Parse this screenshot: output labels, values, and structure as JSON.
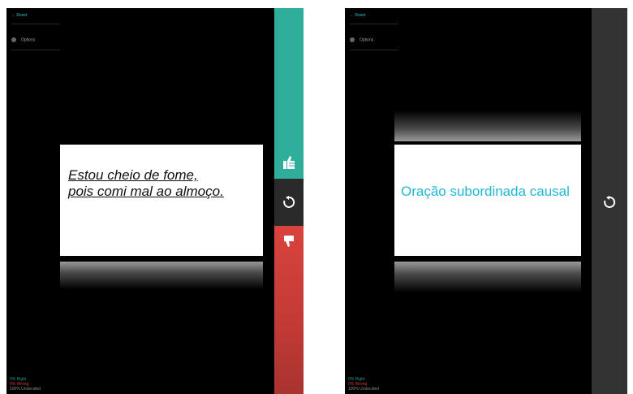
{
  "left": {
    "header": {
      "back_label": "← Reset",
      "options_label": "Options"
    },
    "sentence_line1": "Estou cheio de fome,",
    "sentence_line2": "pois comi mal ao almoço.",
    "actions": {
      "right_icon": "thumbs-up-icon",
      "undo_icon": "undo-icon",
      "wrong_icon": "thumbs-down-icon"
    },
    "stats": {
      "right": "0% Right",
      "wrong": "0% Wrong",
      "undecided": "100% Undecided"
    },
    "colors": {
      "right": "#2eae9b",
      "undo": "#2a2a2a",
      "wrong": "#d9433d"
    }
  },
  "right": {
    "header": {
      "back_label": "← Reset",
      "options_label": "Options"
    },
    "answer": "Oração subordinada causal",
    "actions": {
      "undo_icon": "undo-icon"
    },
    "stats": {
      "right": "0% Right",
      "wrong": "0% Wrong",
      "undecided": "100% Undecided"
    },
    "colors": {
      "answer": "#20b8d0",
      "panel": "#333333"
    }
  }
}
